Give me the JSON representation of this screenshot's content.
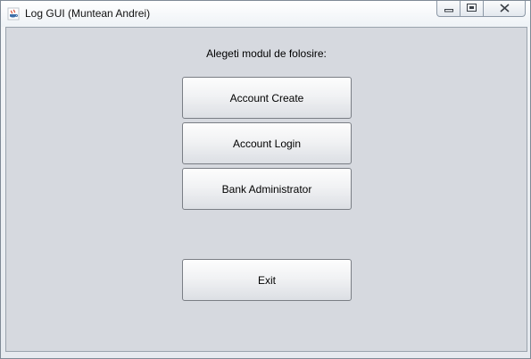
{
  "window": {
    "title": "Log GUI (Muntean Andrei)",
    "icon": "java-cup-icon",
    "controls": [
      "minimize-icon",
      "maximize-icon",
      "close-icon"
    ]
  },
  "main": {
    "prompt": "Alegeti modul de folosire:",
    "buttons": {
      "create": "Account Create",
      "login": "Account Login",
      "admin": "Bank Administrator",
      "exit": "Exit"
    }
  },
  "colors": {
    "panel": "#d6d9df",
    "button_border": "#7a7e85"
  }
}
